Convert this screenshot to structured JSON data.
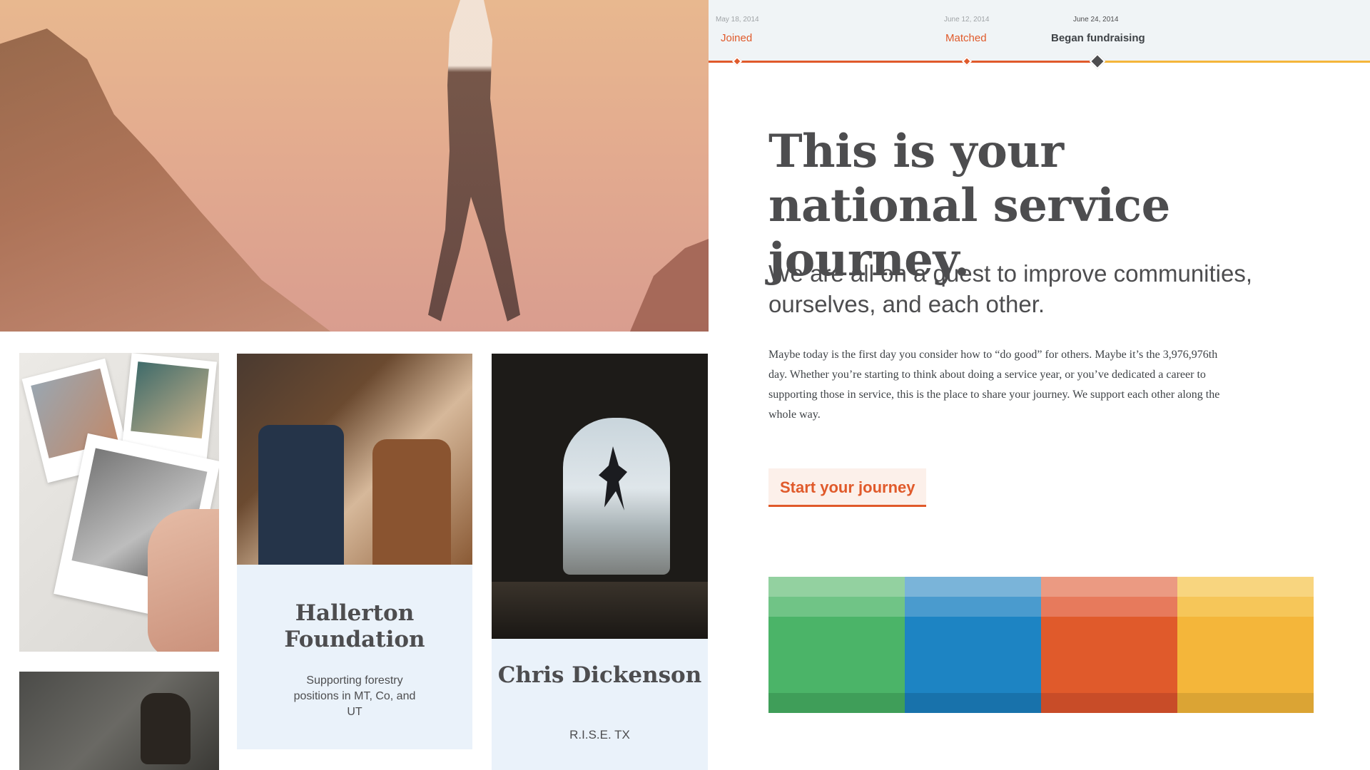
{
  "timeline": {
    "steps": [
      {
        "date": "May 18, 2014",
        "label": "Joined"
      },
      {
        "date": "June 12, 2014",
        "label": "Matched"
      },
      {
        "date": "June 24, 2014",
        "label": "Began fundraising"
      }
    ],
    "colors": {
      "done": "#e05a2b",
      "upcoming": "#f4b63a",
      "current": "#4d4d4f"
    }
  },
  "hero": {
    "headline": "This is your national service journey.",
    "subhead": "We are all on a quest to improve communities, ourselves, and each other.",
    "body": "Maybe today is the first day you consider how to “do good” for others. Maybe it’s the 3,976,976th day. Whether you’re starting to think about doing a service year, or you’ve dedicated a career to supporting those in service, this is the place to share your journey. We support each other along the whole way.",
    "cta_label": "Start your journey"
  },
  "cards": {
    "hallerton": {
      "title": "Hallerton Foundation",
      "subtitle": "Supporting forestry positions in MT, Co, and UT"
    },
    "chris": {
      "title": "Chris Dickenson",
      "subtitle": "R.I.S.E. TX"
    }
  },
  "palette": [
    {
      "name": "green",
      "shades": [
        "#93d1a0",
        "#70c486",
        "#4bb468",
        "#3f9e59"
      ]
    },
    {
      "name": "blue",
      "shades": [
        "#7ab4d9",
        "#4a9bce",
        "#1d84c3",
        "#1872ab"
      ]
    },
    {
      "name": "orange",
      "shades": [
        "#eb9a82",
        "#e77a5c",
        "#e05a2b",
        "#c84c28"
      ]
    },
    {
      "name": "yellow",
      "shades": [
        "#f8d57f",
        "#f6c659",
        "#f4b63a",
        "#dba434"
      ]
    }
  ]
}
